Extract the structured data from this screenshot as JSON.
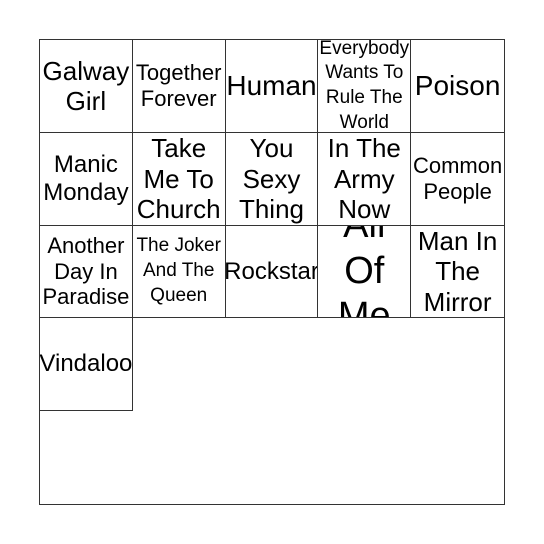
{
  "card": {
    "cells": [
      "Galway Girl",
      "Together Forever",
      "Human",
      "Everybody Wants To Rule The World",
      "Poison",
      "Manic Monday",
      "Take Me To Church",
      "You Sexy Thing",
      "In The Army Now",
      "Common People",
      "Another Day In Paradise",
      "The Joker And The Queen",
      "Rockstar",
      "All Of Me",
      "Man In The Mirror",
      "Vindaloo"
    ]
  }
}
